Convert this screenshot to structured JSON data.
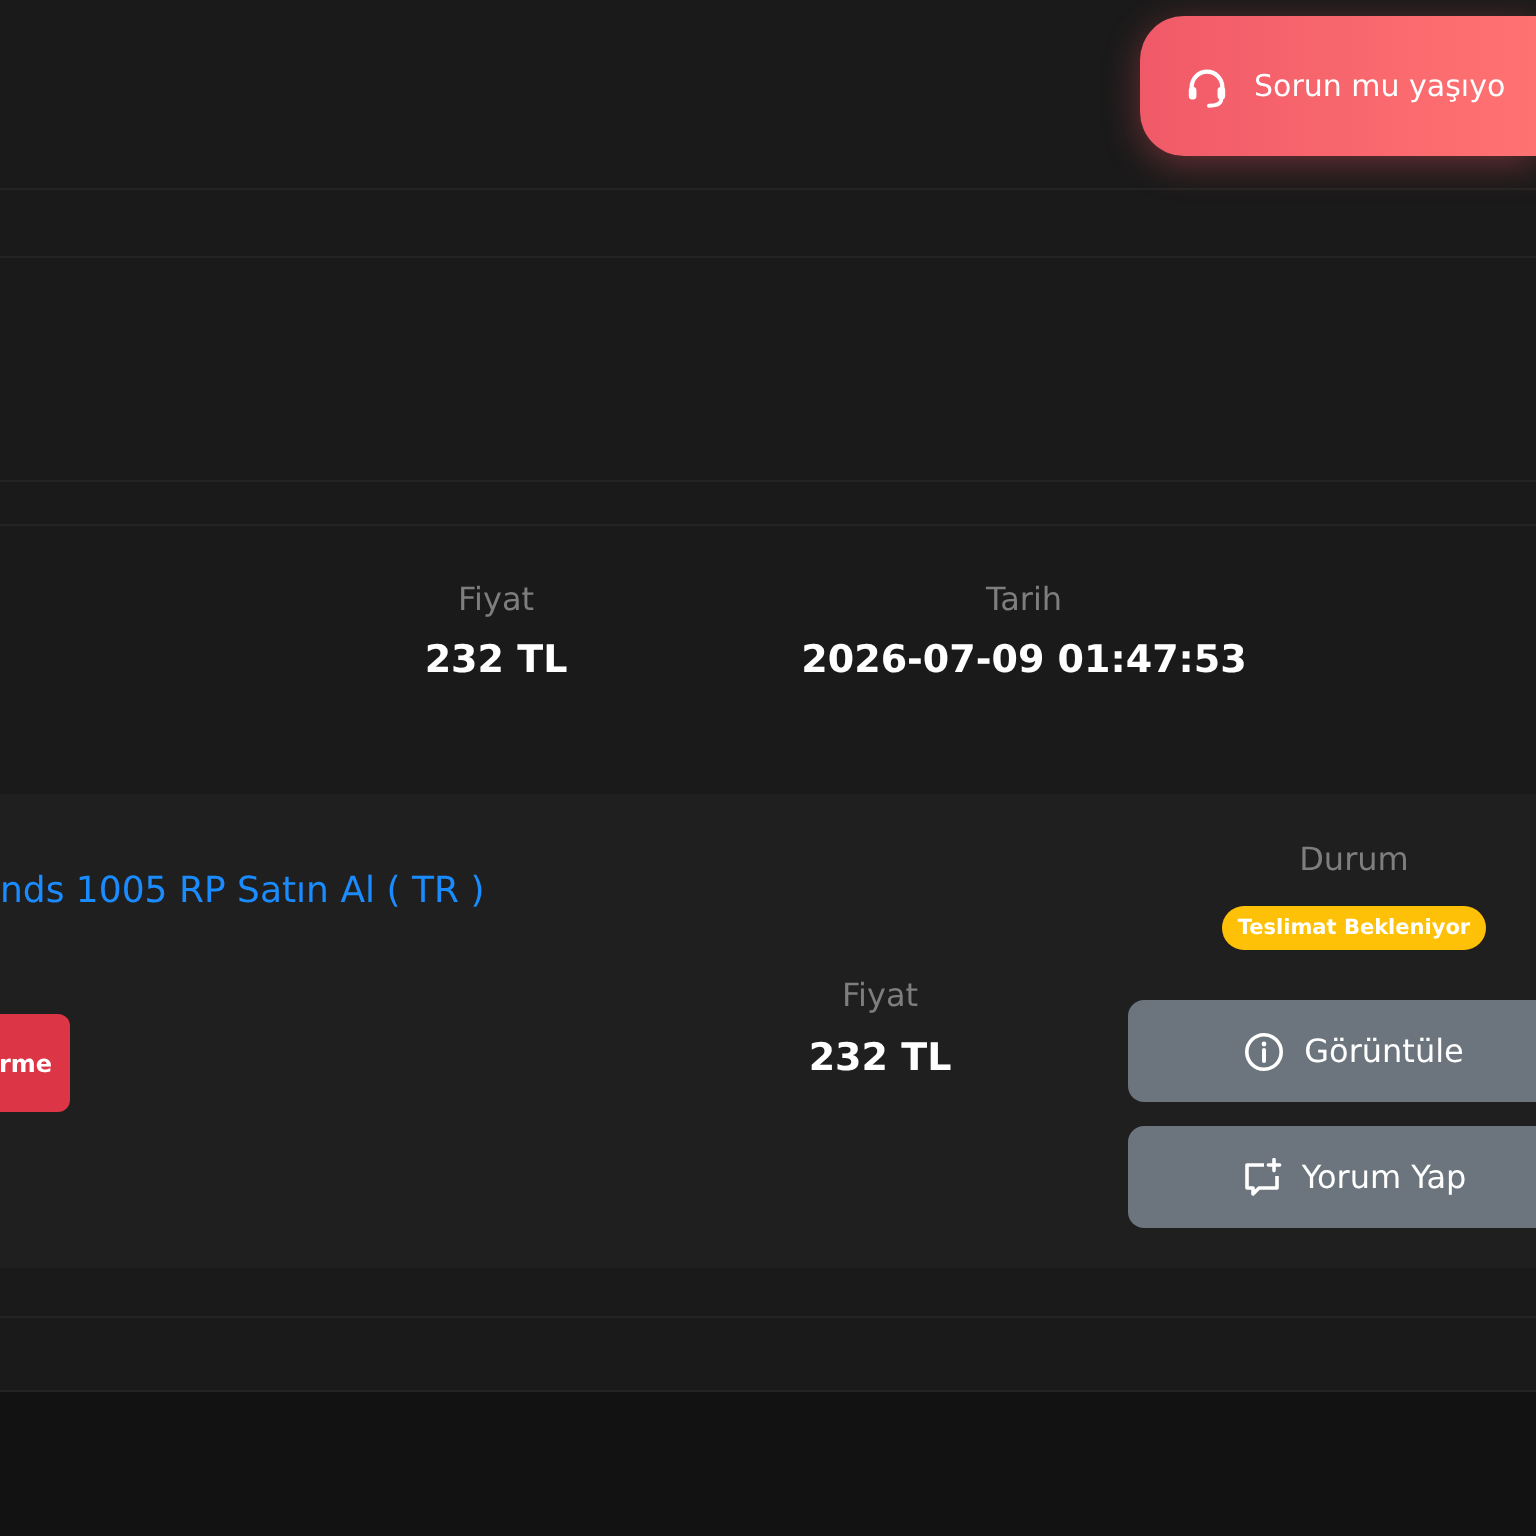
{
  "help_button": {
    "label": "Sorun mu yaşıyo"
  },
  "order_summary": {
    "price_label": "Fiyat",
    "price": "232 TL",
    "date_label": "Tarih",
    "date": "2026-07-09 01:47:53"
  },
  "order_card": {
    "title": "nds 1005 RP Satın Al ( TR )",
    "action_button": "rme",
    "price_label": "Fiyat",
    "price": "232 TL",
    "status_label": "Durum",
    "status": "Teslimat Bekleniyor",
    "buttons": [
      {
        "kind": "view",
        "label": "Görüntüle"
      },
      {
        "kind": "comment",
        "label": "Yorum Yap"
      }
    ]
  }
}
